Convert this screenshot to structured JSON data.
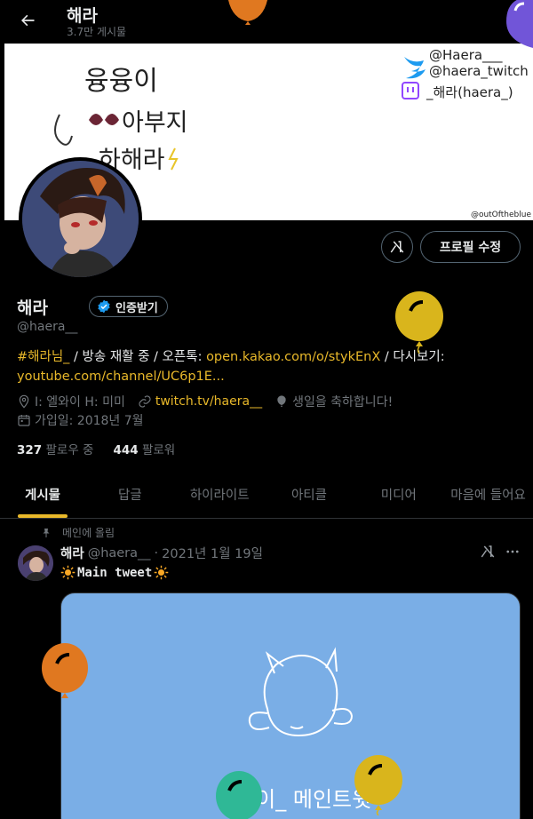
{
  "topbar": {
    "name": "해라",
    "post_count": "3.7만 게시물"
  },
  "banner": {
    "line1": "융융이",
    "line2": "아부지",
    "line3": "하해라",
    "twitter_1": "@Haera___",
    "twitter_2": "@haera_twitch",
    "twitch": "_해라(haera_)",
    "credit": "@outOftheblue"
  },
  "profile": {
    "edit_label": "프로필 수정",
    "name": "해라",
    "verify_label": "인증받기",
    "handle": "@haera__",
    "bio_hashtag": "#해라님_",
    "bio_text1": " / 방송 재활 중 / 오픈톡: ",
    "bio_link1": "open.kakao.com/o/stykEnX",
    "bio_text2": " / 다시보기: ",
    "bio_link2": "youtube.com/channel/UC6p1E...",
    "location": "I: 엘와이 H: 미미",
    "website": "twitch.tv/haera__",
    "birthday": "생일을 축하합니다!",
    "joined": "가입일: 2018년 7월",
    "following_count": "327",
    "following_label": "팔로우 중",
    "followers_count": "444",
    "followers_label": "팔로워"
  },
  "tabs": [
    {
      "label": "게시물"
    },
    {
      "label": "답글"
    },
    {
      "label": "하이라이트"
    },
    {
      "label": "아티클"
    },
    {
      "label": "미디어"
    },
    {
      "label": "마음에 들어요"
    }
  ],
  "tweet": {
    "pinned_label": "메인에 올림",
    "name": "해라",
    "handle": "@haera__",
    "sep": "·",
    "date": "2021년 1월 19일",
    "text": "Main tweet",
    "media_text": "융융이_ 메인트윗"
  },
  "colors": {
    "accent": "#e8b82a",
    "balloon_orange": "#e07820",
    "balloon_yellow": "#d9b51c",
    "balloon_purple": "#7155d8",
    "balloon_teal": "#2fb896"
  }
}
